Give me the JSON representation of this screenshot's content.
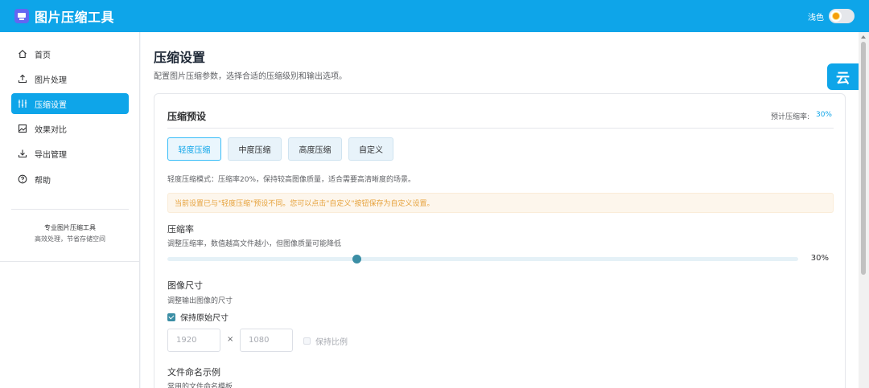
{
  "header": {
    "app_title": "图片压缩工具",
    "theme_label": "浅色"
  },
  "sidebar": {
    "items": [
      {
        "label": "首页",
        "icon": "home-icon"
      },
      {
        "label": "图片处理",
        "icon": "upload-icon"
      },
      {
        "label": "压缩设置",
        "icon": "sliders-icon",
        "active": true
      },
      {
        "label": "效果对比",
        "icon": "image-compare-icon"
      },
      {
        "label": "导出管理",
        "icon": "download-icon"
      },
      {
        "label": "帮助",
        "icon": "help-icon"
      }
    ],
    "footer_title": "专业图片压缩工具",
    "footer_subtitle": "高效处理，节省存储空间"
  },
  "main": {
    "title": "压缩设置",
    "subtitle": "配置图片压缩参数，选择合适的压缩级别和输出选项。"
  },
  "card": {
    "title": "压缩预设",
    "estimate_label": "预计压缩率:",
    "estimate_value": "30%",
    "presets": [
      "轻度压缩",
      "中度压缩",
      "高度压缩",
      "自定义"
    ],
    "active_preset": 0,
    "preset_description": "轻度压缩模式：压缩率20%，保持较高图像质量，适合需要高清晰度的场景。",
    "warning": "当前设置已与\"轻度压缩\"预设不同。您可以点击\"自定义\"按钮保存为自定义设置。",
    "compression": {
      "label": "压缩率",
      "help": "调整压缩率，数值越高文件越小，但图像质量可能降低",
      "value_percent": 30,
      "value_text": "30%"
    },
    "image_size": {
      "label": "图像尺寸",
      "help": "调整输出图像的尺寸",
      "keep_original_label": "保持原始尺寸",
      "keep_original_checked": true,
      "width_placeholder": "1920",
      "height_placeholder": "1080",
      "times": "×",
      "keep_ratio_label": "保持比例",
      "keep_ratio_checked": false
    },
    "naming": {
      "label": "文件命名示例",
      "help": "常用的文件命名模板"
    }
  },
  "floating": {
    "glyph": "云"
  },
  "colors": {
    "accent": "#0ea5e9",
    "slider": "#3b8ea5",
    "warning_text": "#e6a23c"
  }
}
